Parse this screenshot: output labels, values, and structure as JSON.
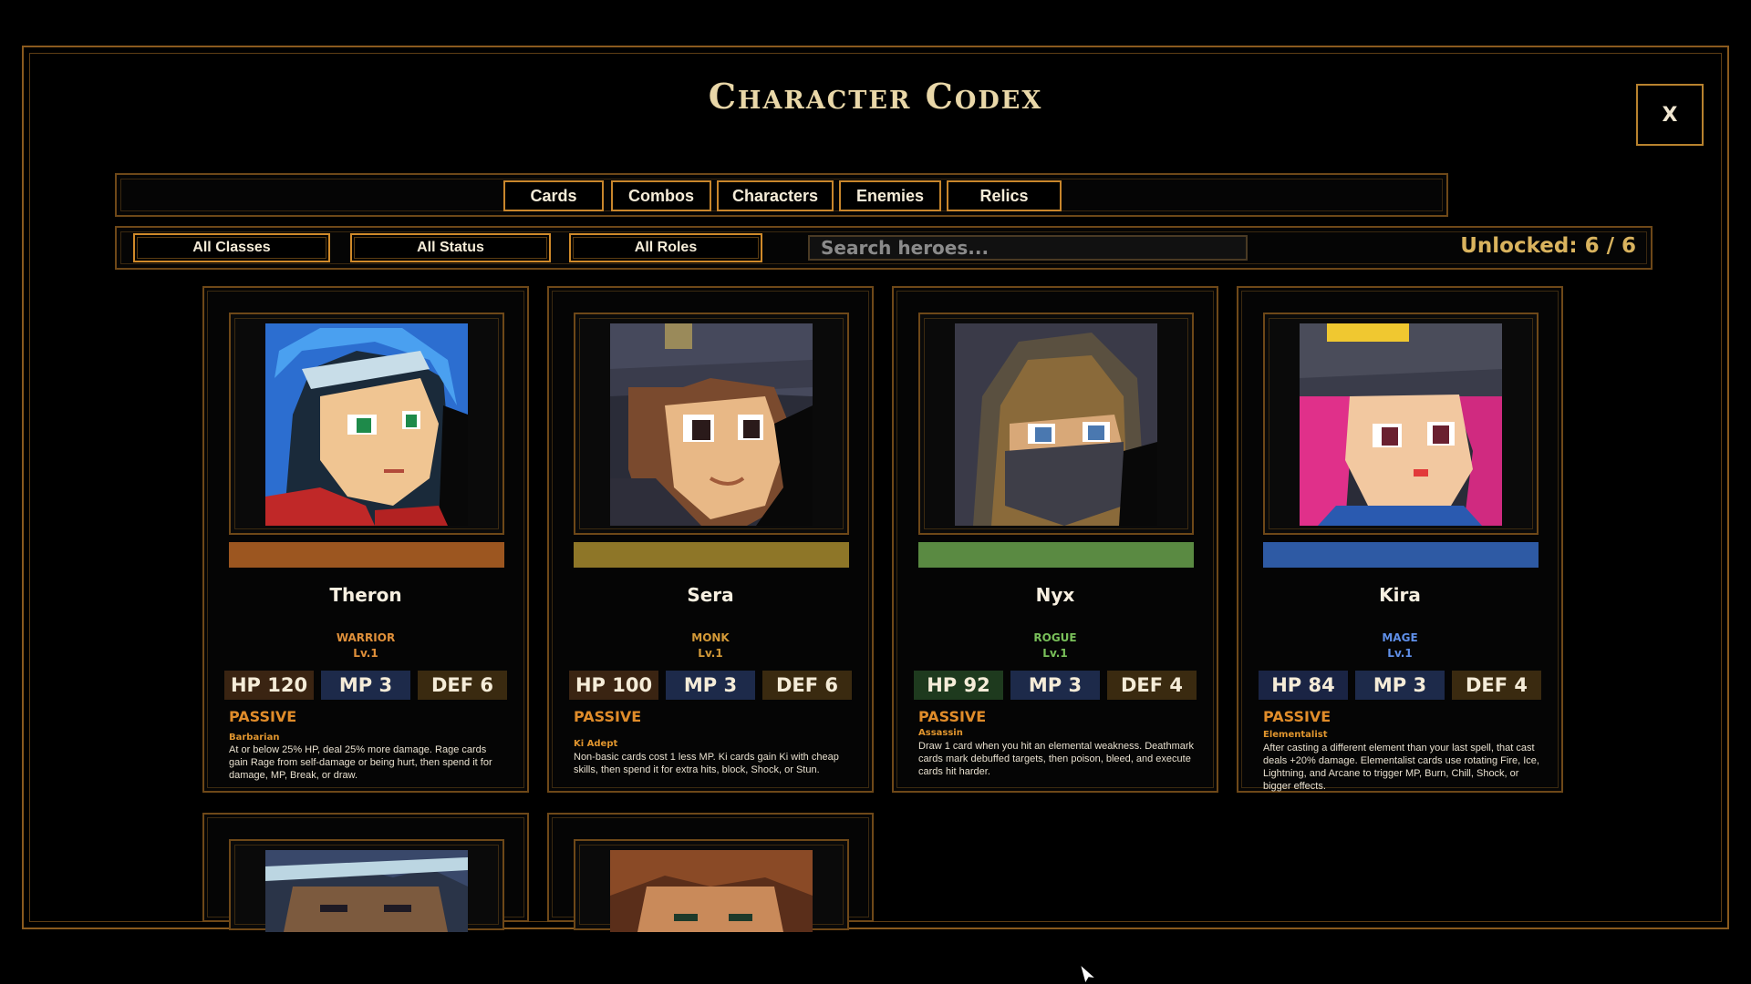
{
  "title": "Character Codex",
  "close_label": "X",
  "tabs": [
    {
      "label": "Cards"
    },
    {
      "label": "Combos"
    },
    {
      "label": "Characters"
    },
    {
      "label": "Enemies"
    },
    {
      "label": "Relics"
    }
  ],
  "filters": {
    "classes": "All Classes",
    "status": "All Status",
    "roles": "All Roles",
    "search_placeholder": "Search heroes...",
    "unlocked": "Unlocked: 6 / 6"
  },
  "colors": {
    "warrior": "#e0903a",
    "monk": "#c99a3c",
    "rogue": "#79c05a",
    "mage": "#5f8fe8",
    "hp_bg": "#3a2412",
    "mp_bg": "#1d2a4a",
    "def_bg": "#3a2a10"
  },
  "heroes": [
    {
      "name": "Theron",
      "class": "WARRIOR",
      "level": "Lv.1",
      "hp": "HP 120",
      "mp": "MP 3",
      "def": "DEF 6",
      "passive_title": "PASSIVE",
      "passive_name": "Barbarian",
      "passive_desc": "At or below 25% HP, deal 25% more damage. Rage cards gain Rage from self-damage or being hurt, then spend it for damage, MP, Break, or draw.",
      "bar_color": "#9c5620",
      "class_color": "#e0903a",
      "hp_bg": "#3a2412",
      "portrait": "blue-haired-warrior-portrait"
    },
    {
      "name": "Sera",
      "class": "MONK",
      "level": "Lv.1",
      "hp": "HP 100",
      "mp": "MP 3",
      "def": "DEF 6",
      "passive_title": "PASSIVE",
      "passive_name": "Ki Adept",
      "passive_desc": "Non-basic cards cost 1 less MP. Ki cards gain Ki with cheap skills, then spend it for extra hits, block, Shock, or Stun.",
      "bar_color": "#8e7628",
      "class_color": "#d49a38",
      "hp_bg": "#3a2412",
      "portrait": "monk-portrait"
    },
    {
      "name": "Nyx",
      "class": "ROGUE",
      "level": "Lv.1",
      "hp": "HP 92",
      "mp": "MP 3",
      "def": "DEF 4",
      "passive_title": "PASSIVE",
      "passive_name": "Assassin",
      "passive_desc": "Draw 1 card when you hit an elemental weakness. Deathmark cards mark debuffed targets, then poison, bleed, and execute cards hit harder.",
      "bar_color": "#5a8a42",
      "class_color": "#79c05a",
      "hp_bg": "#1e3a1e",
      "portrait": "hooded-rogue-portrait"
    },
    {
      "name": "Kira",
      "class": "MAGE",
      "level": "Lv.1",
      "hp": "HP 84",
      "mp": "MP 3",
      "def": "DEF 4",
      "passive_title": "PASSIVE",
      "passive_name": "Elementalist",
      "passive_desc": "After casting a different element than your last spell, that cast deals +20% damage. Elementalist cards use rotating Fire, Ice, Lightning, and Arcane to trigger MP, Burn, Chill, Shock, or bigger effects.",
      "bar_color": "#2e5aa4",
      "class_color": "#5f8fe8",
      "hp_bg": "#1a2444",
      "portrait": "pink-haired-mage-portrait"
    }
  ]
}
